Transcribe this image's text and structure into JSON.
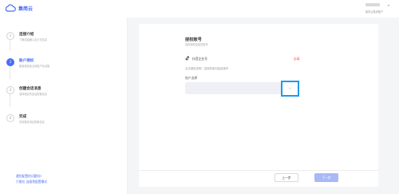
{
  "header": {
    "brand": "集简云",
    "user_sub": "集简云集成账户",
    "brand_color": "#4a6cf7"
  },
  "steps": [
    {
      "num": "1",
      "title": "连接介绍",
      "desc": "了解连接器以及方式信息"
    },
    {
      "num": "2",
      "title": "账户授权",
      "desc": "配置授权给当前账户信息集"
    },
    {
      "num": "3",
      "title": "创建会话消息",
      "desc": "选择指定的会话配置信息"
    },
    {
      "num": "4",
      "title": "完成",
      "desc": "完成集成消息配置信息"
    }
  ],
  "help": {
    "question": "遇到配置的问题吗?",
    "links": "只需在 连接到配置模式"
  },
  "main": {
    "section_title": "授权账号",
    "section_desc": "选择授权连接的账号",
    "platform_name": "抖音企业号",
    "platform_status": "必填",
    "auth_note": "点击授权说明：如授权如何连接操作",
    "account_label": "账户选择",
    "account_value": "",
    "prev_label": "上一步",
    "next_label": "下一步"
  }
}
